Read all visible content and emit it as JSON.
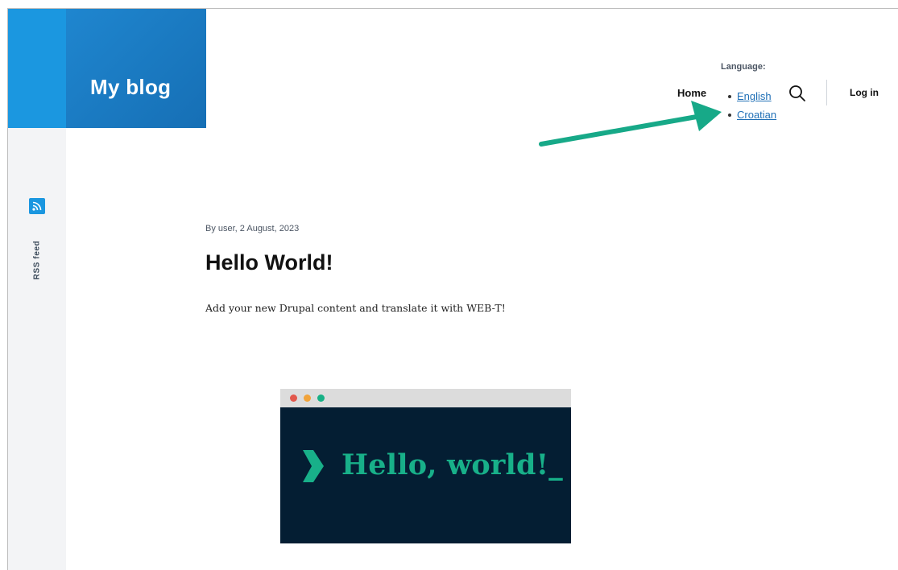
{
  "site": {
    "name": "My blog"
  },
  "sidebar": {
    "rss_label": "RSS feed",
    "icon": "rss-icon"
  },
  "header": {
    "language_heading": "Language:",
    "nav_home": "Home",
    "languages": [
      "English",
      "Croatian"
    ],
    "search_icon": "search-icon",
    "login": "Log in"
  },
  "article": {
    "meta": "By user, 2 August, 2023",
    "title": "Hello World!",
    "body": "Add your new Drupal content and translate it with WEB-T!",
    "image_text": "Hello, world!_"
  },
  "colors": {
    "brand_blue": "#1b97e0",
    "link_blue": "#1f6fb6",
    "arrow_green": "#17a988",
    "image_bg": "#041e33",
    "image_green": "#18b089",
    "dot_red": "#e2574c",
    "dot_orange": "#f1a33a",
    "dot_green": "#16b085"
  }
}
